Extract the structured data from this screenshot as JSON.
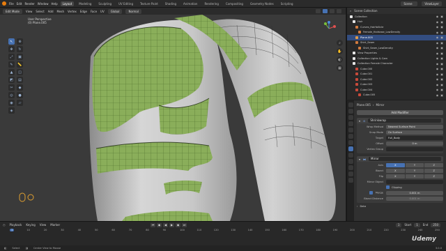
{
  "topbar": {
    "menus": [
      "File",
      "Edit",
      "Render",
      "Window",
      "Help"
    ],
    "workspaces": [
      "Layout",
      "Modeling",
      "Sculpting",
      "UV Editing",
      "Texture Paint",
      "Shading",
      "Animation",
      "Rendering",
      "Compositing",
      "Geometry Nodes",
      "Scripting"
    ],
    "scene": "Scene",
    "view_layer": "ViewLayer"
  },
  "viewport_header": {
    "mode": "Edit Mode",
    "menus": [
      "View",
      "Select",
      "Add",
      "Mesh",
      "Vertex",
      "Edge",
      "Face",
      "UV"
    ],
    "transform_orientation": "Global",
    "pivot": "Normal",
    "options": "Options"
  },
  "viewport": {
    "perspective_label": "User Perspective",
    "object_label": "(0) Plane.005"
  },
  "outliner": {
    "title": "Scene Collection",
    "rows": [
      {
        "label": "Collection",
        "color": "#e6e6e6",
        "indent": 4,
        "selected": false
      },
      {
        "label": "Hair",
        "color": "#e6e6e6",
        "indent": 8,
        "selected": false
      },
      {
        "label": "Curves_Hairfollicle",
        "color": "#d17b3f",
        "indent": 12,
        "selected": false
      },
      {
        "label": "Female_Hairbase_LowDensity",
        "color": "#d17b3f",
        "indent": 16,
        "selected": false
      },
      {
        "label": "Plane.005",
        "color": "#e09b4a",
        "indent": 12,
        "selected": true
      },
      {
        "label": "Shirt_Seam",
        "color": "#d17b3f",
        "indent": 12,
        "selected": false
      },
      {
        "label": "Shirt_Seam_LowDensity",
        "color": "#d17b3f",
        "indent": 16,
        "selected": false
      },
      {
        "label": "View Properties",
        "color": "#e6e6e6",
        "indent": 8,
        "selected": false
      },
      {
        "label": "Collection Lights & Cam",
        "color": "#e6e6e6",
        "indent": 8,
        "selected": false
      },
      {
        "label": "Collection Female Character",
        "color": "#e6e6e6",
        "indent": 8,
        "selected": false
      },
      {
        "label": "Cube.000",
        "color": "#c94a3a",
        "indent": 12,
        "selected": false
      },
      {
        "label": "Cube.001",
        "color": "#c94a3a",
        "indent": 12,
        "selected": false
      },
      {
        "label": "Cube.002",
        "color": "#c94a3a",
        "indent": 12,
        "selected": false
      },
      {
        "label": "Cube.003",
        "color": "#c94a3a",
        "indent": 12,
        "selected": false
      },
      {
        "label": "Cube.004",
        "color": "#c94a3a",
        "indent": 12,
        "selected": false
      },
      {
        "label": "Cube.005",
        "color": "#c94a3a",
        "indent": 16,
        "selected": false
      }
    ]
  },
  "properties": {
    "object_name": "Plane.005",
    "modifier_breadcrumb": "Mirror",
    "add_modifier": "Add Modifier",
    "shrinkwrap": {
      "name": "Shrinkwrap",
      "wrap_method_label": "Wrap Method",
      "wrap_method": "Nearest Surface Point",
      "snap_mode_label": "Snap Mode",
      "snap_mode": "On Surface",
      "target_label": "Target",
      "target": "Full_Body",
      "offset_label": "Offset",
      "offset": "0 m",
      "vertex_group_label": "Vertex Group"
    },
    "mirror": {
      "name": "Mirror",
      "axis_label": "Axis",
      "bisect_label": "Bisect",
      "flip_label": "Flip",
      "axes": [
        "X",
        "Y",
        "Z"
      ],
      "mirror_object_label": "Mirror Object",
      "clipping_label": "Clipping",
      "merge_label": "Merge",
      "merge_value": "0.001 m",
      "bisect_distance_label": "Bisect Distance",
      "bisect_distance_value": "0.001 m",
      "data_label": "Data"
    }
  },
  "timeline": {
    "menus": [
      "Playback",
      "Keying",
      "View",
      "Marker"
    ],
    "current_frame": "1",
    "start_label": "Start",
    "start": "1",
    "end_label": "End",
    "end": "250",
    "ticks": [
      "1",
      "10",
      "20",
      "30",
      "40",
      "50",
      "60",
      "70",
      "80",
      "90",
      "100",
      "110",
      "120",
      "130",
      "140",
      "150",
      "160",
      "170",
      "180",
      "190",
      "200",
      "210",
      "220",
      "230",
      "240",
      "250"
    ]
  },
  "statusbar": {
    "hints": [
      "Select",
      "Center View to Mouse"
    ],
    "version": "3.0.0"
  },
  "watermark": "Udemy",
  "colors": {
    "accent": "#4772b3",
    "mesh_green": "#8aae5a"
  }
}
